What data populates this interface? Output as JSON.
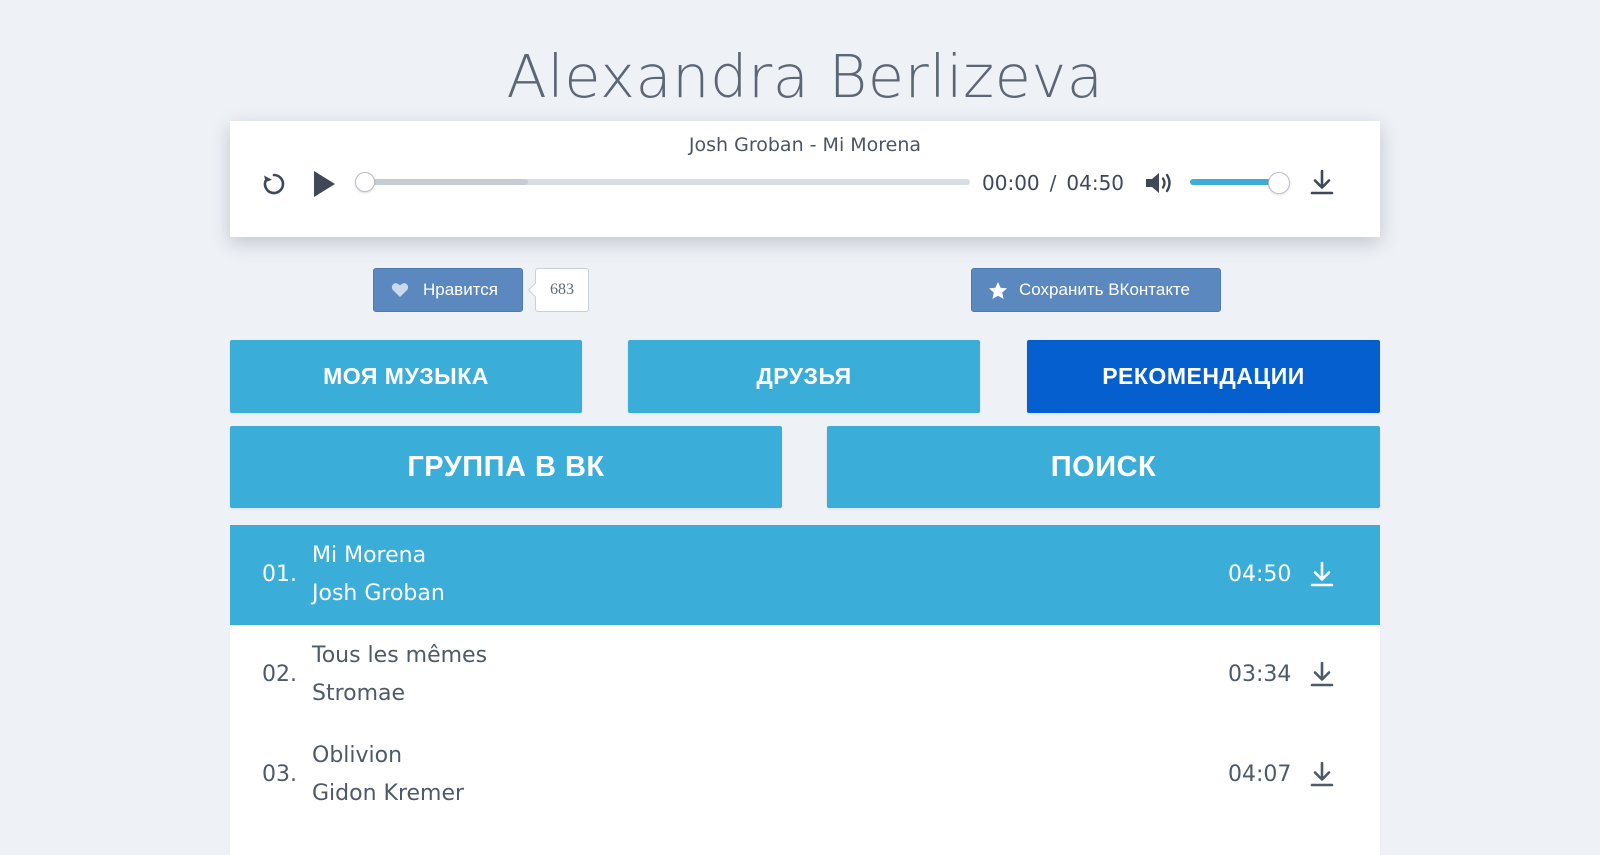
{
  "page": {
    "title": "Alexandra Berlizeva"
  },
  "player": {
    "now_playing": "Josh Groban - Mi Morena",
    "current_time": "00:00",
    "time_separator": "/",
    "total_time": "04:50",
    "progress_fraction": 0.0,
    "buffered_fraction": 0.27,
    "volume_fraction": 0.97,
    "icons": {
      "replay": "replay-icon",
      "play": "play-icon",
      "volume": "volume-icon",
      "download": "download-icon"
    }
  },
  "social": {
    "like_label": "Нравится",
    "like_count": "683",
    "save_label": "Сохранить ВКонтакте",
    "icons": {
      "like": "heart-icon",
      "save": "star-icon"
    }
  },
  "nav": {
    "my_music": "МОЯ МУЗЫКА",
    "friends": "ДРУЗЬЯ",
    "recommendations": "РЕКОМЕНДАЦИИ",
    "vk_group": "ГРУППА В ВК",
    "search": "ПОИСК",
    "active": "recommendations"
  },
  "tracks": [
    {
      "num": "01.",
      "title": "Mi Morena",
      "artist": "Josh Groban",
      "duration": "04:50",
      "active": true
    },
    {
      "num": "02.",
      "title": "Tous les mêmes",
      "artist": "Stromae",
      "duration": "03:34",
      "active": false
    },
    {
      "num": "03.",
      "title": "Oblivion",
      "artist": "Gidon Kremer",
      "duration": "04:07",
      "active": false
    }
  ],
  "colors": {
    "accent": "#3aaed8",
    "nav_active": "#065fce",
    "vk_button": "#5b88bf",
    "background": "#eef1f6"
  }
}
